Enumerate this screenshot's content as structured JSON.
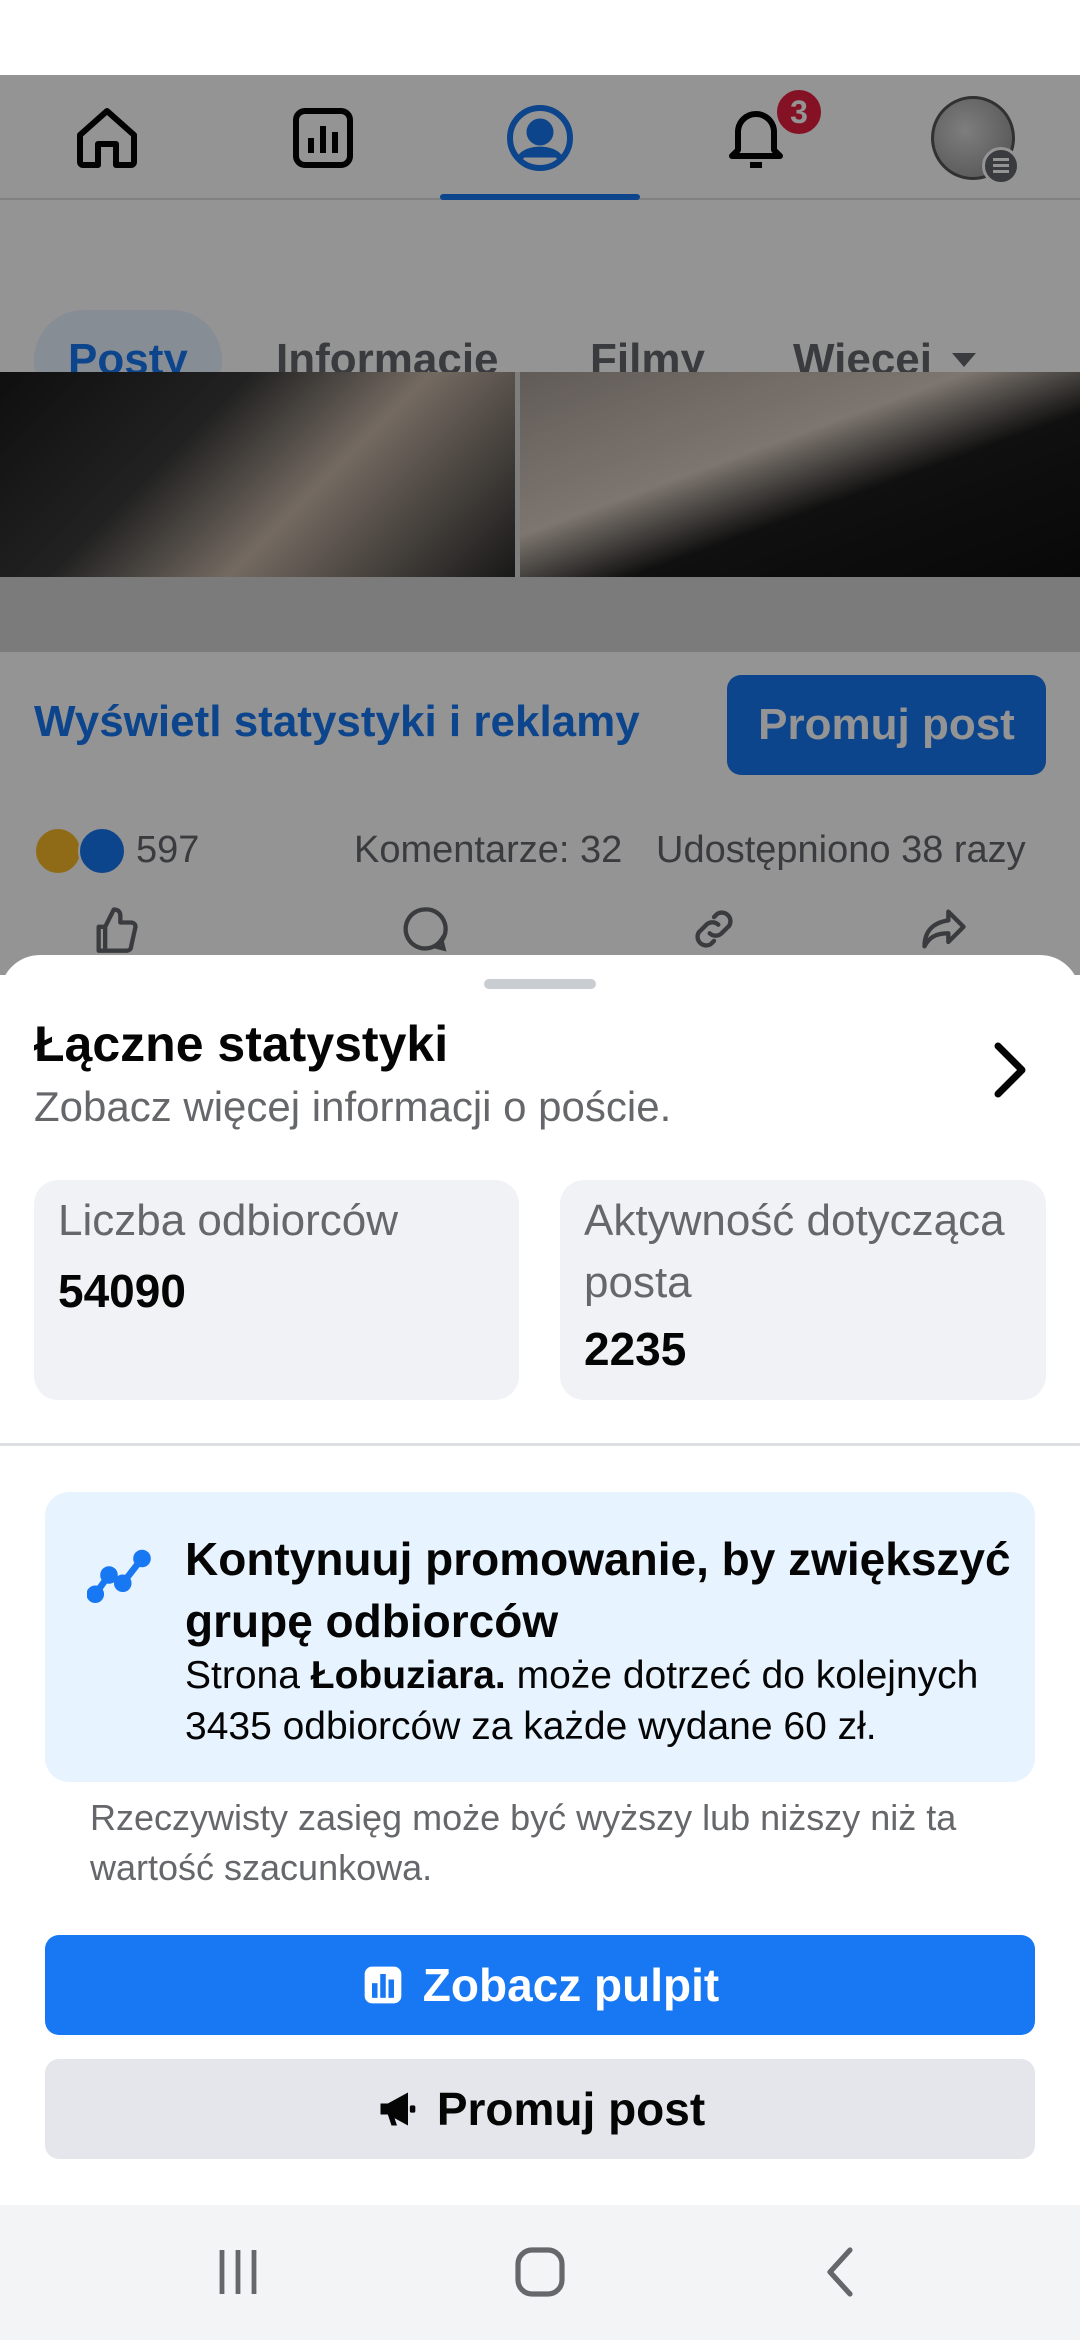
{
  "nav": {
    "tabs": [
      {
        "name": "home-icon"
      },
      {
        "name": "dashboard-icon"
      },
      {
        "name": "profile-icon",
        "active": true
      },
      {
        "name": "notifications-icon",
        "badge": "3"
      },
      {
        "name": "avatar-menu"
      }
    ]
  },
  "subtabs": {
    "posts": "Posty",
    "info": "Informacje",
    "videos": "Filmy",
    "more": "Więcej"
  },
  "post": {
    "insights_link": "Wyświetl statystyki i reklamy",
    "promote_button": "Promuj post",
    "reaction_count": "597",
    "comments": "Komentarze: 32",
    "shares": "Udostępniono 38 razy"
  },
  "sheet": {
    "title": "Łączne statystyki",
    "subtitle": "Zobacz więcej informacji o poście.",
    "stats": [
      {
        "label": "Liczba odbiorców",
        "value": "54090"
      },
      {
        "label": "Aktywność dotycząca posta",
        "value": "2235"
      }
    ],
    "promo": {
      "heading": "Kontynuuj promowanie, by zwiększyć grupę odbiorców",
      "body_prefix": "Strona ",
      "page_name": "Łobuziara.",
      "body_suffix": " może dotrzeć do kolejnych 3435 odbiorców za każde wydane 60 zł."
    },
    "disclaimer": "Rzeczywisty zasięg może być wyższy lub niższy niż ta wartość szacunkowa.",
    "dashboard_button": "Zobacz pulpit",
    "promote_button": "Promuj post"
  },
  "colors": {
    "accent": "#1877f2",
    "badge": "#e41e3f",
    "card_bg": "#f0f2f5",
    "promo_bg": "#e7f3ff"
  }
}
